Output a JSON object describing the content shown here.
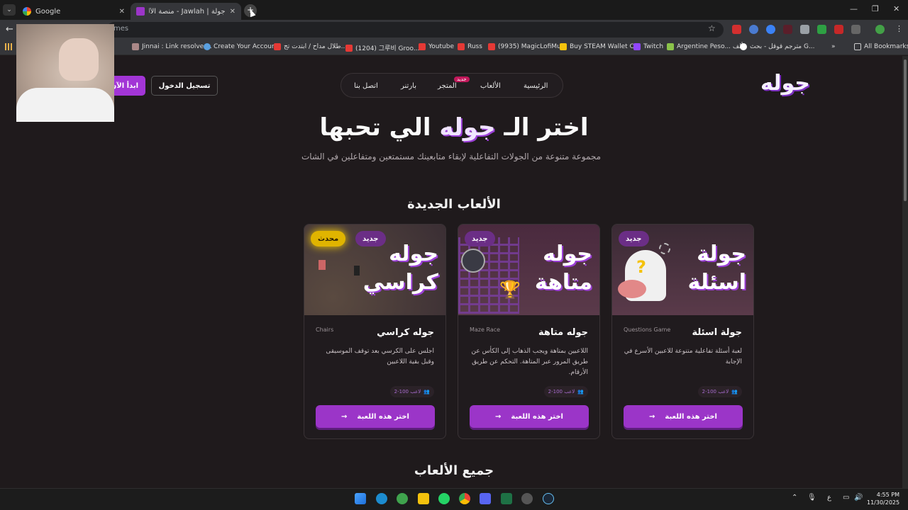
{
  "browser": {
    "tabs": [
      {
        "title": "Google",
        "active": false
      },
      {
        "title": "جولة | Jawlah - منصة الألعاب الت...",
        "active": true
      }
    ],
    "address_partial": "mes",
    "bookmarks": [
      "Jinnai : Link resolver...",
      "Create Your Account",
      "طلال مداح / ابتدت تج...",
      "(1204) 그루비 Groo...",
      "Youtube",
      "Russ",
      "(9935) MagicLofiMu...",
      "Buy STEAM Wallet C...",
      "Twitch",
      "Argentine Peso... ألف",
      "مترجم قوقل - بحث G...",
      "All Bookmarks"
    ]
  },
  "site": {
    "logo": "جوله",
    "nav": [
      "الرئيسية",
      "الألعاب",
      "المتجر",
      "بارتنر",
      "اتصل بنا"
    ],
    "nav_new_badge": "جديد",
    "login": "تسجيل الدخول",
    "start": "ابدأ الآن",
    "hero_pre": "اختر الـ",
    "hero_accent": "جوله",
    "hero_post": "الي تحبها",
    "subtitle": "مجموعة متنوعة من الجولات التفاعلية لإبقاء متابعينك مستمتعين ومتفاعلين في الشات",
    "new_games_title": "الألعاب الجديدة",
    "all_games_title": "جميع الألعاب"
  },
  "cards": [
    {
      "art": "جولة اسئلة",
      "badge_new": "جديد",
      "title": "جولة اسئلة",
      "subtitle": "Questions Game",
      "desc": "لعبة أسئلة تفاعلية متنوعة للاعبين الأسرع في الإجابة",
      "players": "2-100 لاعب",
      "button": "اختر هذه اللعبة"
    },
    {
      "art": "جوله متاهة",
      "badge_new": "جديد",
      "title": "جوله متاهة",
      "subtitle": "Maze Race",
      "desc": "اللاعبين بمتاهة ويجب الذهاب إلى الكأس عن طريق المرور عبر المتاهة. التحكم عن طريق الأرقام.",
      "players": "2-100 لاعب",
      "button": "اختر هذه اللعبة"
    },
    {
      "art": "جوله كراسي",
      "badge_new": "جديد",
      "badge_updated": "محدث",
      "title": "جوله كراسي",
      "subtitle": "Chairs",
      "desc": "اجلس على الكرسي بعد توقف الموسيقى وقبل بقية اللاعبين",
      "players": "2-100 لاعب",
      "button": "اختر هذه اللعبة"
    }
  ],
  "taskbar": {
    "lang": "ع",
    "time": "4:55 PM",
    "date": "11/30/2025"
  },
  "colors": {
    "accent": "#9b35c8",
    "badge_yellow": "#e0b400",
    "bg": "#1f1a1c"
  }
}
